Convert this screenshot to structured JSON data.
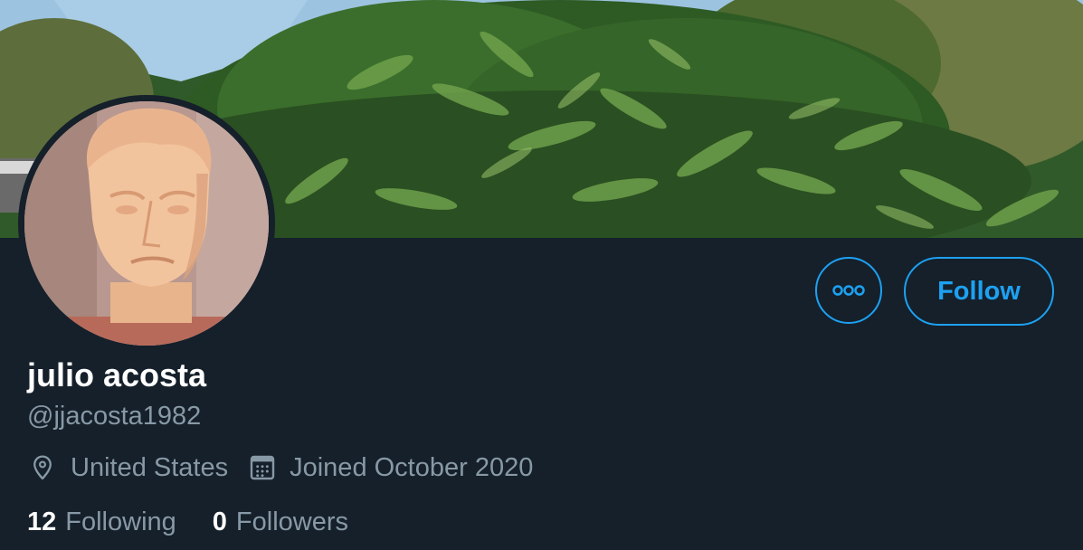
{
  "profile": {
    "display_name": "julio acosta",
    "handle": "@jjacosta1982",
    "location": "United States",
    "joined": "Joined October 2020"
  },
  "actions": {
    "more_icon": "more-horizontal-icon",
    "follow_label": "Follow"
  },
  "counts": {
    "following_count": "12",
    "following_label": "Following",
    "followers_count": "0",
    "followers_label": "Followers"
  },
  "icons": {
    "location": "location-pin-icon",
    "joined": "calendar-icon"
  },
  "colors": {
    "background": "#15202b",
    "accent": "#1da1f2",
    "primary_text": "#ffffff",
    "secondary_text": "#8899a6"
  }
}
